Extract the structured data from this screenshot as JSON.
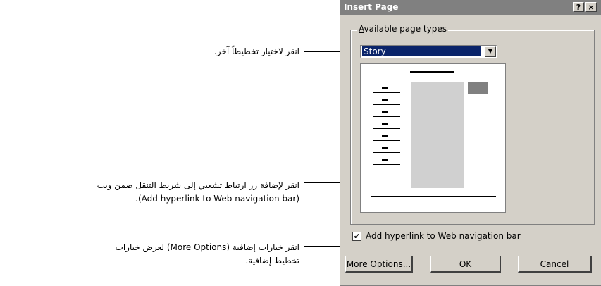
{
  "callouts": {
    "layout": "انقر لاختيار تخطيطاً آخر.",
    "hyperlink_line1": "انقر لإضافة  زر ارتباط تشعبي إلى شريط التنقل ضمن ويب",
    "hyperlink_line2": "(Add hyperlink to Web navigation bar).",
    "options_line1": "انقر خيارات إضافية (More Options) لعرض خيارات",
    "options_line2": "تخطيط إضافية."
  },
  "dialog": {
    "title": "Insert Page",
    "help_button": "?",
    "close_button": "×",
    "group_label_mnemonic": "A",
    "group_label_rest": "vailable page types",
    "page_type": {
      "selected": "Story"
    },
    "checkbox": {
      "checked": true,
      "label_pre": "Add ",
      "label_mnemonic": "h",
      "label_post": "yperlink to Web navigation bar"
    },
    "buttons": {
      "more_pre": "More ",
      "more_mnemonic": "O",
      "more_post": "ptions...",
      "ok": "OK",
      "cancel": "Cancel"
    }
  },
  "icons": {
    "dropdown": "chevron-down-icon",
    "check": "checkmark-icon"
  }
}
